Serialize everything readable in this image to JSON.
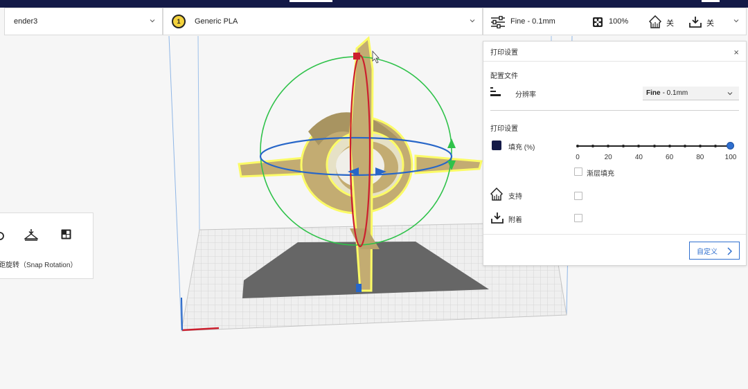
{
  "topbar": {
    "printer": "ender3",
    "material_badge": "1",
    "material": "Generic PLA",
    "profile_summary": "Fine - 0.1mm",
    "infill_summary": "100%",
    "support_summary": "关",
    "adhesion_summary": "关"
  },
  "print_panel": {
    "title": "打印设置",
    "close": "×",
    "profile_section": "配置文件",
    "resolution_label": "分辨率",
    "resolution_bold": "Fine",
    "resolution_rest": "- 0.1mm",
    "settings_section": "打印设置",
    "infill_label": "填充 (%)",
    "infill_value_percent": 100,
    "infill_ticks": [
      "0",
      "20",
      "40",
      "60",
      "80",
      "100"
    ],
    "gradual_label": "渐层填充",
    "support_label": "支持",
    "adhesion_label": "附着",
    "custom_button": "自定义"
  },
  "rotate_tool": {
    "caption": "寻距旋转（Snap Rotation）",
    "icons": [
      "rotate-icon",
      "lay-flat-icon",
      "select-face-icon"
    ]
  },
  "colors": {
    "accent": "#2f6fcf",
    "header": "#141a47",
    "model": "#c3ac72",
    "rotate_green": "#2fc24a",
    "rotate_red": "#cc1f2e",
    "rotate_blue": "#2766c8"
  }
}
